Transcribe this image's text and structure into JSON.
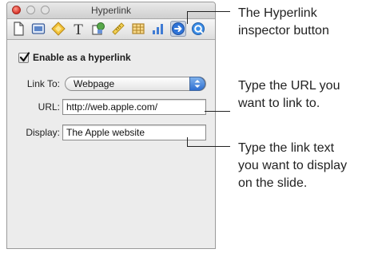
{
  "window": {
    "title": "Hyperlink"
  },
  "toolbar": {
    "icons": [
      "document-icon",
      "slide-icon",
      "build-icon",
      "text-icon",
      "graphic-icon",
      "metrics-icon",
      "table-icon",
      "chart-icon",
      "hyperlink-icon",
      "quicktime-icon"
    ],
    "selected": "hyperlink-icon"
  },
  "hyperlink": {
    "enable_label": "Enable as a hyperlink",
    "enabled": true,
    "link_to_label": "Link To:",
    "link_to_value": "Webpage",
    "url_label": "URL:",
    "url_value": "http://web.apple.com/",
    "display_label": "Display:",
    "display_value": "The Apple website"
  },
  "callouts": {
    "inspector_line1": "The Hyperlink",
    "inspector_line2": "inspector button",
    "url_line1": "Type the URL you",
    "url_line2": "want to link to.",
    "display_line1": "Type the link text",
    "display_line2": "you want to display",
    "display_line3": "on the slide."
  }
}
